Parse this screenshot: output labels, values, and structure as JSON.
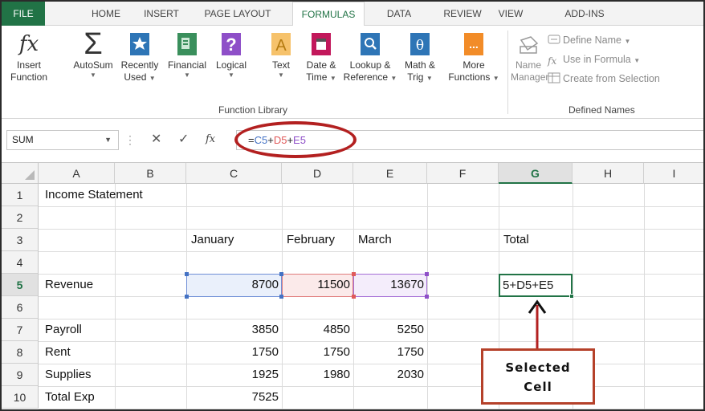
{
  "ribbon_tabs": [
    "FILE",
    "HOME",
    "INSERT",
    "PAGE LAYOUT",
    "FORMULAS",
    "DATA",
    "REVIEW",
    "VIEW",
    "ADD-INS"
  ],
  "active_tab": "FORMULAS",
  "function_library": {
    "label": "Function Library",
    "insert_function": [
      "Insert",
      "Function"
    ],
    "autosum": "AutoSum",
    "recently_used": [
      "Recently",
      "Used"
    ],
    "financial": "Financial",
    "logical": "Logical",
    "text": "Text",
    "date_time": [
      "Date &",
      "Time"
    ],
    "lookup_reference": [
      "Lookup &",
      "Reference"
    ],
    "math_trig": [
      "Math &",
      "Trig"
    ],
    "more_functions": [
      "More",
      "Functions"
    ]
  },
  "defined_names": {
    "label": "Defined Names",
    "name_manager": [
      "Name",
      "Manager"
    ],
    "define_name": "Define Name",
    "use_in_formula": "Use in Formula",
    "create_from_selection": "Create from Selection"
  },
  "formula_bar": {
    "name_box": "SUM",
    "formula_eq": "=",
    "ref_c5": "C5",
    "plus1": "+",
    "ref_d5": "D5",
    "plus2": "+",
    "ref_e5": "E5"
  },
  "columns": [
    "A",
    "B",
    "C",
    "D",
    "E",
    "F",
    "G",
    "H",
    "I"
  ],
  "rows": [
    "1",
    "2",
    "3",
    "4",
    "5",
    "6",
    "7",
    "8",
    "9",
    "10"
  ],
  "cells": {
    "a1": "Income Statement",
    "c3": "January",
    "d3": "February",
    "e3": "March",
    "g3": "Total",
    "a5": "Revenue",
    "c5": "8700",
    "d5": "11500",
    "e5": "13670",
    "g5": "5+D5+E5",
    "a7": "Payroll",
    "c7": "3850",
    "d7": "4850",
    "e7": "5250",
    "a8": "Rent",
    "c8": "1750",
    "d8": "1750",
    "e8": "1750",
    "a9": "Supplies",
    "c9": "1925",
    "d9": "1980",
    "e9": "2030",
    "a10": "Total Exp",
    "c10": "7525"
  },
  "callout": [
    "Selected",
    "Cell"
  ],
  "colors": {
    "excel_green": "#217346",
    "ref_blue": "#4472c4",
    "ref_red": "#e05a5a",
    "ref_purple": "#8e4fc8",
    "annotation_red": "#b32020"
  }
}
